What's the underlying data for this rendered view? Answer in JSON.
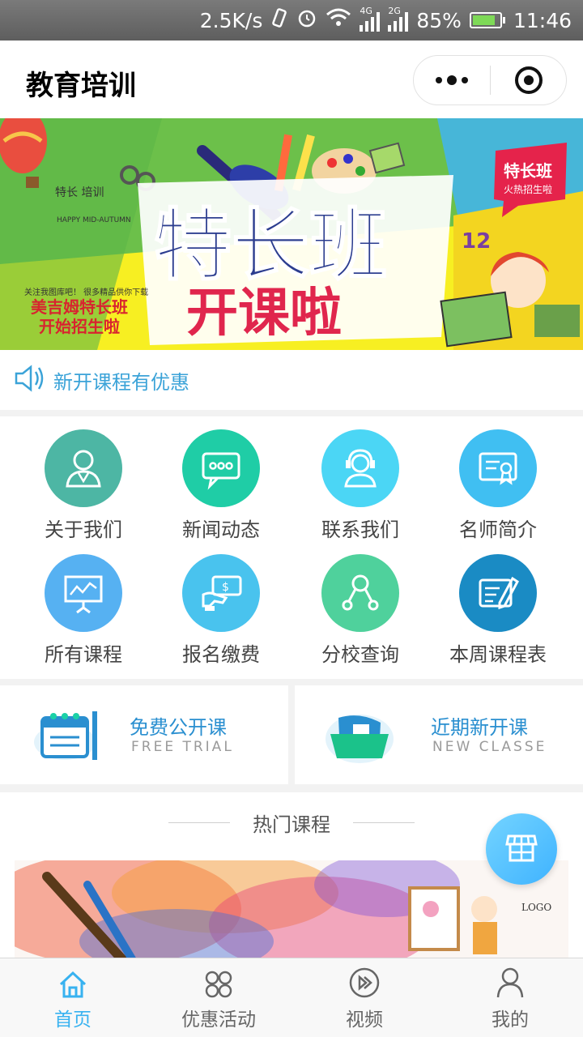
{
  "status_bar": {
    "speed": "2.5K/s",
    "net1": "4G",
    "net2": "2G",
    "battery": "85%",
    "battery_level": 0.85,
    "time": "11:46"
  },
  "navbar": {
    "title": "教育培训"
  },
  "banner": {
    "main_title": "特长班",
    "sub_title": "开课啦",
    "badge_line1": "特长班",
    "badge_line2": "火热招生啦",
    "left_tag": "特长 培训",
    "promo_small": "关注我图库吧！ 很多精品供你下载",
    "promo_line1": "美吉姆特长班",
    "promo_line2": "开始招生啦",
    "tagline": "HAPPY MID-AUTUMN",
    "numbers": "12"
  },
  "notice": {
    "text": "新开课程有优惠"
  },
  "grid": [
    {
      "label": "关于我们",
      "color": "#4db6a4",
      "icon": "person-icon"
    },
    {
      "label": "新闻动态",
      "color": "#1fcda6",
      "icon": "chat-icon"
    },
    {
      "label": "联系我们",
      "color": "#4bd6f5",
      "icon": "support-icon"
    },
    {
      "label": "名师简介",
      "color": "#40bff2",
      "icon": "certificate-icon"
    },
    {
      "label": "所有课程",
      "color": "#56b1f2",
      "icon": "presentation-icon"
    },
    {
      "label": "报名缴费",
      "color": "#49c3ee",
      "icon": "payment-icon"
    },
    {
      "label": "分校查询",
      "color": "#4fd19c",
      "icon": "branch-icon"
    },
    {
      "label": "本周课程表",
      "color": "#1a8bc4",
      "icon": "schedule-icon"
    }
  ],
  "cards": [
    {
      "title": "免费公开课",
      "subtitle": "FREE TRIAL"
    },
    {
      "title": "近期新开课",
      "subtitle": "NEW CLASSE"
    }
  ],
  "hot": {
    "title": "热门课程",
    "logo": "LOGO"
  },
  "tabbar": [
    {
      "label": "首页",
      "active": true
    },
    {
      "label": "优惠活动",
      "active": false
    },
    {
      "label": "视频",
      "active": false
    },
    {
      "label": "我的",
      "active": false
    }
  ]
}
